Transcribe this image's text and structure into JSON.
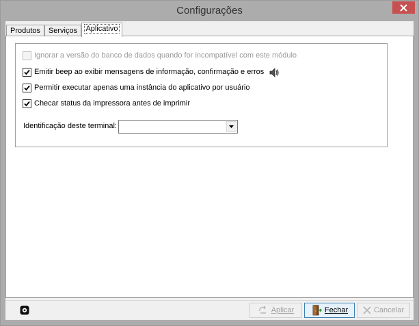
{
  "window": {
    "title": "Configurações"
  },
  "tabs": [
    {
      "label": "Produtos",
      "active": false
    },
    {
      "label": "Serviços",
      "active": false
    },
    {
      "label": "Aplicativo",
      "active": true
    }
  ],
  "options": [
    {
      "label": "Ignorar a versão do banco de dados quando for incompatível com este módulo",
      "checked": false,
      "enabled": false
    },
    {
      "label": "Emitir beep ao exibir mensagens de informação, confirmação e erros",
      "checked": true,
      "enabled": true
    },
    {
      "label": "Permitir executar apenas uma instância do aplicativo por usuário",
      "checked": true,
      "enabled": true
    },
    {
      "label": "Checar status da impressora antes de imprimir",
      "checked": true,
      "enabled": true
    }
  ],
  "terminal": {
    "label": "Identificação deste terminal:",
    "value": ""
  },
  "buttons": {
    "apply": {
      "label": "Aplicar",
      "enabled": false
    },
    "close": {
      "label": "Fechar",
      "enabled": true
    },
    "cancel": {
      "label": "Cancelar",
      "enabled": false
    }
  },
  "colors": {
    "title_bar": "#acacac",
    "close_button": "#c75050"
  },
  "icons": [
    "close-icon",
    "speaker-icon",
    "gear-icon",
    "apply-icon",
    "door-icon",
    "cancel-x-icon",
    "chevron-down-icon"
  ]
}
